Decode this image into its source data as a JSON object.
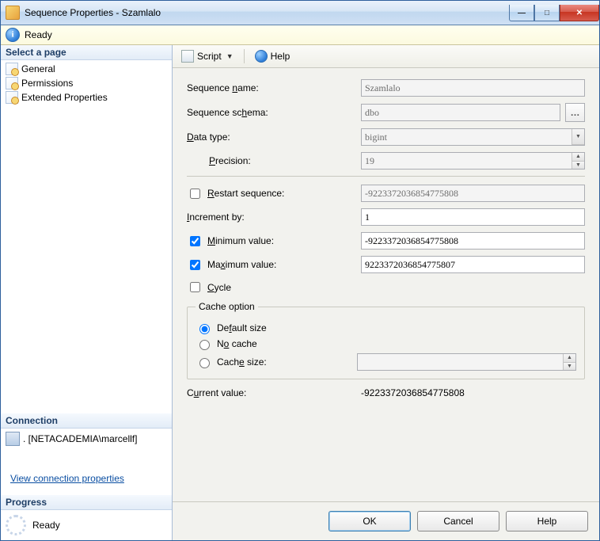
{
  "window": {
    "title": "Sequence Properties - Szamlalo"
  },
  "infobar": {
    "status": "Ready"
  },
  "sidebar": {
    "select_header": "Select a page",
    "pages": [
      {
        "label": "General"
      },
      {
        "label": "Permissions"
      },
      {
        "label": "Extended Properties"
      }
    ],
    "connection_header": "Connection",
    "connection_value": ". [NETACADEMIA\\marcellf]",
    "view_conn_link": "View connection properties",
    "progress_header": "Progress",
    "progress_status": "Ready"
  },
  "toolbar": {
    "script_label": "Script",
    "help_label": "Help"
  },
  "form": {
    "seq_name_label_pre": "Sequence ",
    "seq_name_label_u": "n",
    "seq_name_label_post": "ame:",
    "seq_name_value": "Szamlalo",
    "seq_schema_label_pre": "Sequence sc",
    "seq_schema_label_u": "h",
    "seq_schema_label_post": "ema:",
    "seq_schema_value": "dbo",
    "data_type_label_u": "D",
    "data_type_label_post": "ata type:",
    "data_type_value": "bigint",
    "precision_label_u": "P",
    "precision_label_post": "recision:",
    "precision_value": "19",
    "restart_label_u": "R",
    "restart_label_post": "estart sequence:",
    "restart_checked": false,
    "restart_value": "-9223372036854775808",
    "increment_label_u": "I",
    "increment_label_post": "ncrement by:",
    "increment_value": "1",
    "min_label_u": "M",
    "min_label_post": "inimum value:",
    "min_checked": true,
    "min_value": "-9223372036854775808",
    "max_label_pre": "Ma",
    "max_label_u": "x",
    "max_label_post": "imum value:",
    "max_checked": true,
    "max_value": "9223372036854775807",
    "cycle_label_u": "C",
    "cycle_label_post": "ycle",
    "cycle_checked": false,
    "cache_legend": "Cache option",
    "cache_default_label_pre": "De",
    "cache_default_label_u": "f",
    "cache_default_label_post": "ault size",
    "cache_no_label_pre": "N",
    "cache_no_label_u": "o",
    "cache_no_label_post": " cache",
    "cache_size_label_pre": "Cach",
    "cache_size_label_u": "e",
    "cache_size_label_post": " size:",
    "cache_size_value": "",
    "cache_selected": "default",
    "current_label_pre": "C",
    "current_label_u": "u",
    "current_label_post": "rrent value:",
    "current_value": "-9223372036854775808"
  },
  "buttons": {
    "ok": "OK",
    "cancel": "Cancel",
    "help": "Help"
  }
}
